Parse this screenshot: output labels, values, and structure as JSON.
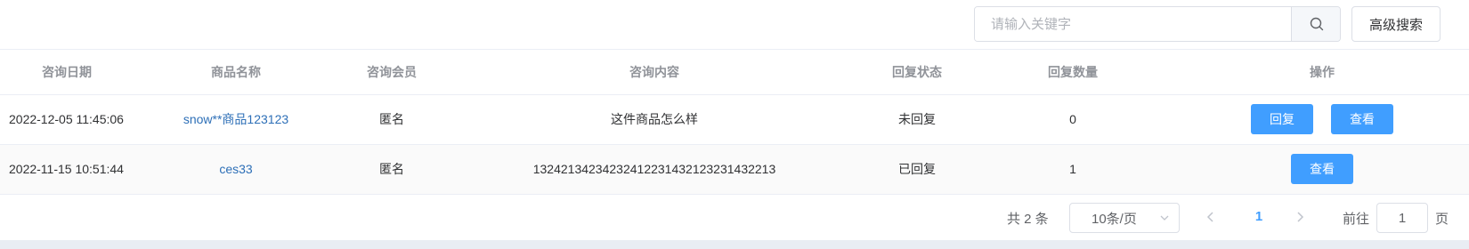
{
  "search": {
    "placeholder": "请输入关键字",
    "value": ""
  },
  "toolbar": {
    "advanced_search_label": "高级搜索"
  },
  "table": {
    "columns": [
      "咨询日期",
      "商品名称",
      "咨询会员",
      "咨询内容",
      "回复状态",
      "回复数量",
      "操作"
    ],
    "rows": [
      {
        "date": "2022-12-05 11:45:06",
        "product": "snow**商品123123",
        "member": "匿名",
        "content": "这件商品怎么样",
        "status": "未回复",
        "reply_count": "0",
        "actions": [
          "回复",
          "查看"
        ]
      },
      {
        "date": "2022-11-15 10:51:44",
        "product": "ces33",
        "member": "匿名",
        "content": "13242134234232412231432123231432213",
        "status": "已回复",
        "reply_count": "1",
        "actions": [
          "查看"
        ]
      }
    ]
  },
  "pagination": {
    "total_text": "共 2 条",
    "page_size": "10条/页",
    "current_page": "1",
    "goto_label": "前往",
    "goto_value": "1",
    "goto_suffix": "页"
  },
  "colors": {
    "primary": "#409eff",
    "link": "#2d6fb7"
  },
  "icons": [
    "search-icon",
    "chevron-down-icon",
    "chevron-left-icon",
    "chevron-right-icon"
  ]
}
